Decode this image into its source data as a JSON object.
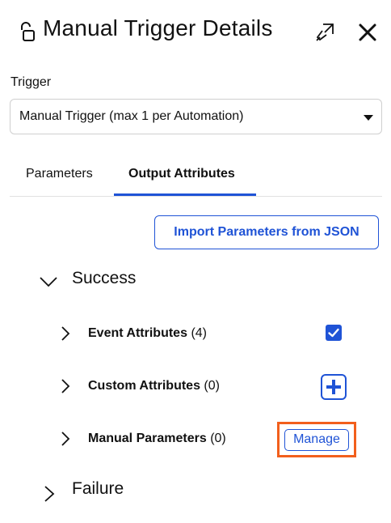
{
  "header": {
    "title": "Manual Trigger Details",
    "icons": {
      "lock": "lock-icon",
      "popout": "popout-icon",
      "close": "close-icon"
    }
  },
  "trigger": {
    "label": "Trigger",
    "selected": "Manual Trigger (max 1 per Automation)"
  },
  "tabs": [
    {
      "label": "Parameters",
      "active": false
    },
    {
      "label": "Output Attributes",
      "active": true
    }
  ],
  "import_button": "Import Parameters from JSON",
  "sections": {
    "success": {
      "label": "Success",
      "expanded": true,
      "rows": [
        {
          "name": "Event Attributes",
          "count": "(4)",
          "control": "checkbox",
          "checked": true
        },
        {
          "name": "Custom Attributes",
          "count": "(0)",
          "control": "add-button"
        },
        {
          "name": "Manual Parameters",
          "count": "(0)",
          "control": "manage-button",
          "control_label": "Manage",
          "highlighted": true
        }
      ]
    },
    "failure": {
      "label": "Failure",
      "expanded": false
    }
  },
  "colors": {
    "accent": "#1f53d6",
    "highlight": "#f25f1c",
    "border": "#cfcfcf"
  }
}
